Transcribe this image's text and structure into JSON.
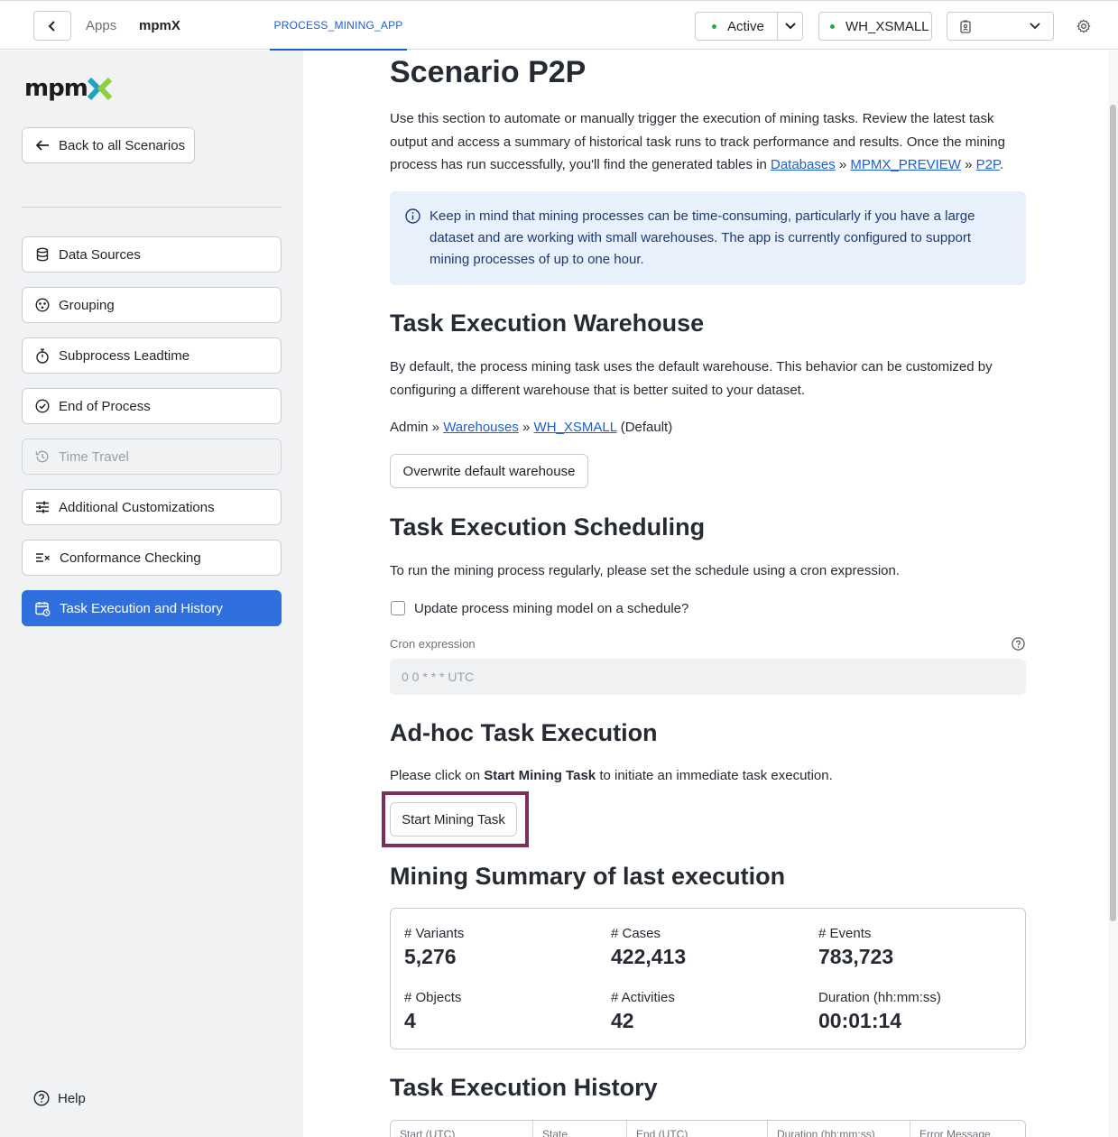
{
  "topbar": {
    "apps_label": "Apps",
    "app_name": "mpmX",
    "tab_label": "PROCESS_MINING_APP",
    "status_label": "Active",
    "warehouse_label": "WH_XSMALL"
  },
  "sidebar": {
    "logo_text": "mpmX",
    "back_label": "Back to all Scenarios",
    "items": [
      {
        "label": "Data Sources",
        "icon": "database-icon"
      },
      {
        "label": "Grouping",
        "icon": "grouping-icon"
      },
      {
        "label": "Subprocess Leadtime",
        "icon": "stopwatch-icon"
      },
      {
        "label": "End of Process",
        "icon": "check-circle-icon"
      },
      {
        "label": "Time Travel",
        "icon": "history-icon"
      },
      {
        "label": "Additional Customizations",
        "icon": "sliders-icon"
      },
      {
        "label": "Conformance Checking",
        "icon": "conformance-icon"
      },
      {
        "label": "Task Execution and History",
        "icon": "calendar-icon"
      }
    ],
    "help_label": "Help"
  },
  "main": {
    "title": "Scenario P2P",
    "intro": "Use this section to automate or manually trigger the execution of mining tasks. Review the latest task output and access a summary of historical task runs to track performance and results. Once the mining process has run successfully, you'll find the generated tables in",
    "intro_links": [
      "Databases",
      "MPMX_PREVIEW",
      "P2P"
    ],
    "info_text": "Keep in mind that mining processes can be time-consuming, particularly if you have a large dataset and are working with small warehouses. The app is currently configured to support mining processes of up to one hour.",
    "warehouse_heading": "Task Execution Warehouse",
    "warehouse_text": "By default, the process mining task uses the default warehouse. This behavior can be customized by configuring a different warehouse that is better suited to your dataset.",
    "warehouse_path_prefix": "Admin »",
    "warehouse_link1": "Warehouses",
    "warehouse_link2": "WH_XSMALL",
    "warehouse_default": "(Default)",
    "overwrite_button": "Overwrite default warehouse",
    "scheduling_heading": "Task Execution Scheduling",
    "scheduling_text": "To run the mining process regularly, please set the schedule using a cron expression.",
    "schedule_checkbox_label": "Update process mining model on a schedule?",
    "cron_label": "Cron expression",
    "cron_placeholder": "0 0 * * * UTC",
    "adhoc_heading": "Ad-hoc Task Execution",
    "adhoc_text_before": "Please click on",
    "adhoc_text_bold": "Start Mining Task",
    "adhoc_text_after": "to initiate an immediate task execution.",
    "start_button": "Start Mining Task",
    "summary_heading": "Mining Summary of last execution",
    "metrics": [
      {
        "label": "# Variants",
        "value": "5,276"
      },
      {
        "label": "# Cases",
        "value": "422,413"
      },
      {
        "label": "# Events",
        "value": "783,723"
      },
      {
        "label": "# Objects",
        "value": "4"
      },
      {
        "label": "# Activities",
        "value": "42"
      },
      {
        "label": "Duration (hh:mm:ss)",
        "value": "00:01:14"
      }
    ],
    "history_heading": "Task Execution History",
    "history_columns": [
      "Start (UTC)",
      "State",
      "End (UTC)",
      "Duration (hh:mm:ss)",
      "Error Message"
    ]
  }
}
